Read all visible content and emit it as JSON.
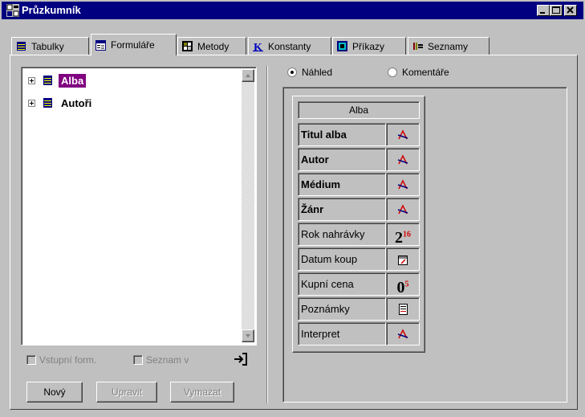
{
  "window": {
    "title": "Průzkumník"
  },
  "colors": {
    "titlebar": "#000080",
    "selection": "#800080",
    "field_icon": "#d00000"
  },
  "tabs": [
    {
      "label": "Tabulky",
      "icon": "table-icon"
    },
    {
      "label": "Formuláře",
      "icon": "form-icon",
      "active": true
    },
    {
      "label": "Metody",
      "icon": "method-icon"
    },
    {
      "label": "Konstanty",
      "icon": "constant-icon"
    },
    {
      "label": "Příkazy",
      "icon": "command-icon"
    },
    {
      "label": "Seznamy",
      "icon": "list-icon"
    }
  ],
  "tree": {
    "items": [
      {
        "label": "Alba",
        "selected": true
      },
      {
        "label": "Autoři",
        "selected": false
      }
    ]
  },
  "options": {
    "vstupni": "Vstupní form.",
    "seznam": "Seznam v"
  },
  "buttons": {
    "new": "Nový",
    "edit": "Upravit",
    "delete": "Vymazat"
  },
  "view": {
    "preview": "Náhled",
    "comments": "Komentáře",
    "selected": "preview"
  },
  "form": {
    "title": "Alba",
    "fields": [
      {
        "name": "Titul alba",
        "bold": true,
        "type": "text",
        "icon": "text-field-icon"
      },
      {
        "name": "Autor",
        "bold": true,
        "type": "text",
        "icon": "text-field-icon"
      },
      {
        "name": "Médium",
        "bold": true,
        "type": "text",
        "icon": "text-field-icon"
      },
      {
        "name": "Žánr",
        "bold": true,
        "type": "text",
        "icon": "text-field-icon"
      },
      {
        "name": "Rok nahrávky",
        "bold": false,
        "type": "integer",
        "icon": "integer-field-icon",
        "glyph": "2",
        "sup": "16"
      },
      {
        "name": "Datum koup",
        "bold": false,
        "type": "date",
        "icon": "date-field-icon"
      },
      {
        "name": "Kupní cena",
        "bold": false,
        "type": "real",
        "icon": "real-field-icon",
        "glyph": "0",
        "sup": "5"
      },
      {
        "name": "Poznámky",
        "bold": false,
        "type": "memo",
        "icon": "memo-field-icon"
      },
      {
        "name": "Interpret",
        "bold": false,
        "type": "text",
        "icon": "text-field-icon"
      }
    ]
  }
}
